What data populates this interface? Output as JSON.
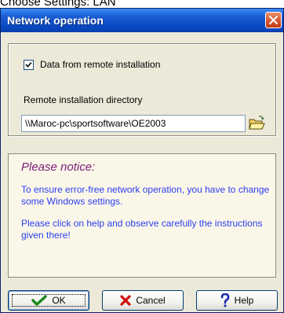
{
  "page_caption": "Choose Settings: LAN",
  "window": {
    "title": "Network operation",
    "close_icon": "close-icon"
  },
  "remote": {
    "checkbox_label": "Data from remote installation",
    "checked": true,
    "directory_label": "Remote installation directory",
    "directory_value": "\\\\Maroc-pc\\sportsoftware\\OE2003",
    "browse_icon": "folder-open-icon"
  },
  "notice": {
    "heading": "Please notice:",
    "paragraph_1": "To ensure error-free network operation, you have to change some Windows settings.",
    "paragraph_2": "Please click on help and observe carefully the instructions given there!"
  },
  "buttons": {
    "ok_label": "OK",
    "cancel_label": "Cancel",
    "help_label": "Help"
  },
  "colors": {
    "notice_heading": "#7a1a7a",
    "notice_text": "#2a3ef0",
    "titlebar": "#0a4ac4"
  }
}
